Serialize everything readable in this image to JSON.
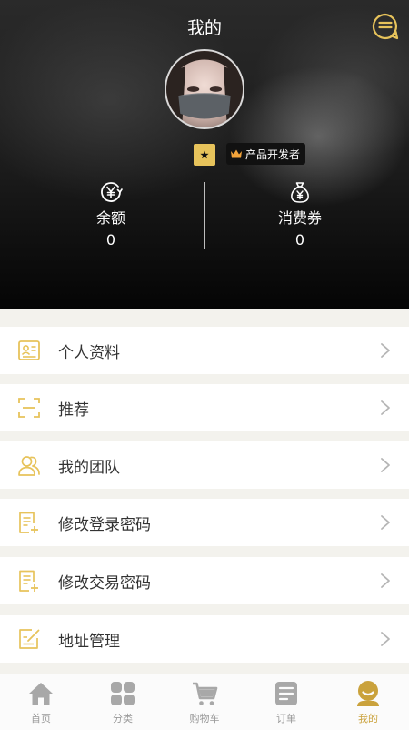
{
  "header": {
    "title": "我的",
    "message_icon": "message-icon"
  },
  "profile": {
    "badge_star": "star-icon",
    "role_badge": "产品开发者"
  },
  "stats": {
    "balance": {
      "label": "余额",
      "value": "0",
      "icon": "yen-icon"
    },
    "coupon": {
      "label": "消费券",
      "value": "0",
      "icon": "money-bag-icon"
    }
  },
  "menu": {
    "items": [
      {
        "label": "个人资料",
        "icon": "profile-card-icon"
      },
      {
        "label": "推荐",
        "icon": "scan-icon"
      },
      {
        "label": "我的团队",
        "icon": "team-icon"
      },
      {
        "label": "修改登录密码",
        "icon": "edit-document-icon"
      },
      {
        "label": "修改交易密码",
        "icon": "edit-document-icon"
      },
      {
        "label": "地址管理",
        "icon": "address-edit-icon"
      }
    ]
  },
  "tabbar": {
    "tabs": [
      {
        "label": "首页",
        "icon": "home-icon"
      },
      {
        "label": "分类",
        "icon": "category-icon"
      },
      {
        "label": "购物车",
        "icon": "cart-icon"
      },
      {
        "label": "订单",
        "icon": "order-icon"
      },
      {
        "label": "我的",
        "icon": "user-icon"
      }
    ]
  },
  "colors": {
    "accent": "#e7c35b",
    "header_bg": "#1b1b1b",
    "page_bg": "#f3f2ed",
    "inactive_tab": "#999999"
  }
}
